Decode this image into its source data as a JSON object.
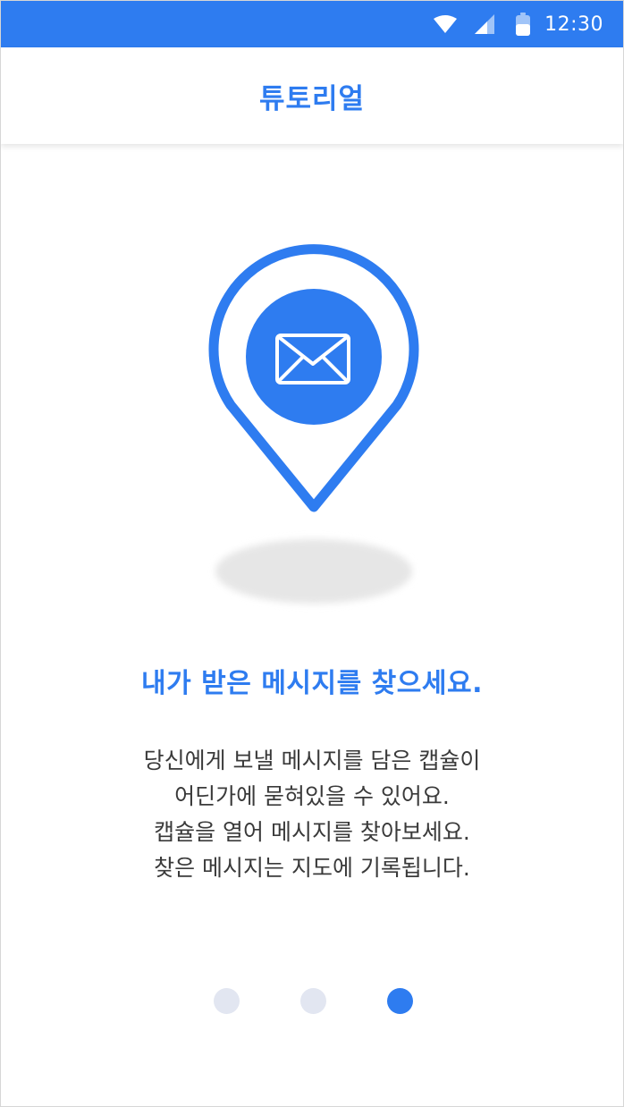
{
  "status_bar": {
    "time": "12:30",
    "icons": [
      "wifi-icon",
      "cell-signal-icon",
      "battery-icon"
    ],
    "color": "#2e7cf0"
  },
  "header": {
    "title": "튜토리얼"
  },
  "illustration": {
    "icon": "map-pin-envelope-icon",
    "accent": "#2e7cf0"
  },
  "content": {
    "headline": "내가 받은 메시지를 찾으세요.",
    "description_lines": [
      "당신에게 보낼 메시지를 담은 캡슐이",
      "어딘가에 묻혀있을 수 있어요.",
      "캡슐을 열어 메시지를 찾아보세요.",
      "찾은 메시지는 지도에 기록됩니다."
    ]
  },
  "pagination": {
    "total": 3,
    "current": 3,
    "active_color": "#2e7cf0",
    "inactive_color": "#e2e6f1"
  }
}
